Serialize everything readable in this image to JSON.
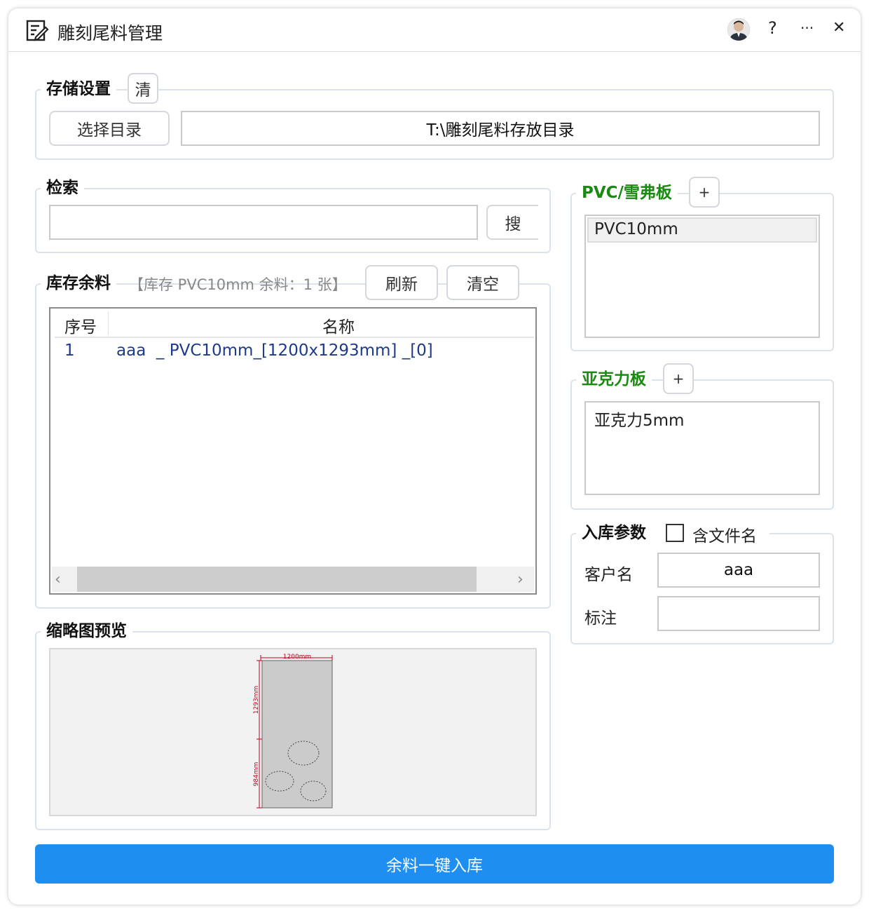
{
  "window": {
    "title": "雕刻尾料管理",
    "help_label": "?",
    "more_label": "···",
    "close_label": "✕"
  },
  "storage": {
    "legend": "存储设置",
    "clear_label": "清",
    "select_dir_label": "选择目录",
    "dir_path": "T:\\雕刻尾料存放目录"
  },
  "search": {
    "legend": "检索",
    "input_value": "",
    "button_label": "搜"
  },
  "inventory": {
    "legend": "库存余料",
    "summary": "【库存 PVC10mm 余料：1 张】",
    "refresh_label": "刷新",
    "clear_label": "清空",
    "columns": [
      "序号",
      "名称"
    ],
    "rows": [
      {
        "index": "1",
        "name": "aaa  _ PVC10mm_[1200x1293mm] _[0]"
      }
    ]
  },
  "preview": {
    "legend": "缩略图预览",
    "width_label": "1200mm",
    "height_label": "1293mm",
    "lower_label": "984mm"
  },
  "pvc": {
    "legend": "PVC/雪弗板",
    "add_label": "+",
    "items": [
      "PVC10mm"
    ]
  },
  "acrylic": {
    "legend": "亚克力板",
    "add_label": "+",
    "items": [
      "亚克力5mm"
    ]
  },
  "params": {
    "legend": "入库参数",
    "checkbox_label": "含文件名",
    "customer_label": "客户名",
    "customer_value": "aaa",
    "note_label": "标注",
    "note_value": ""
  },
  "submit_label": "余料一键入库",
  "colors": {
    "primary": "#1e8ff0",
    "legend_green": "#1a8a12",
    "row_text": "#1f3a8a",
    "dim_red": "#c0001a"
  }
}
